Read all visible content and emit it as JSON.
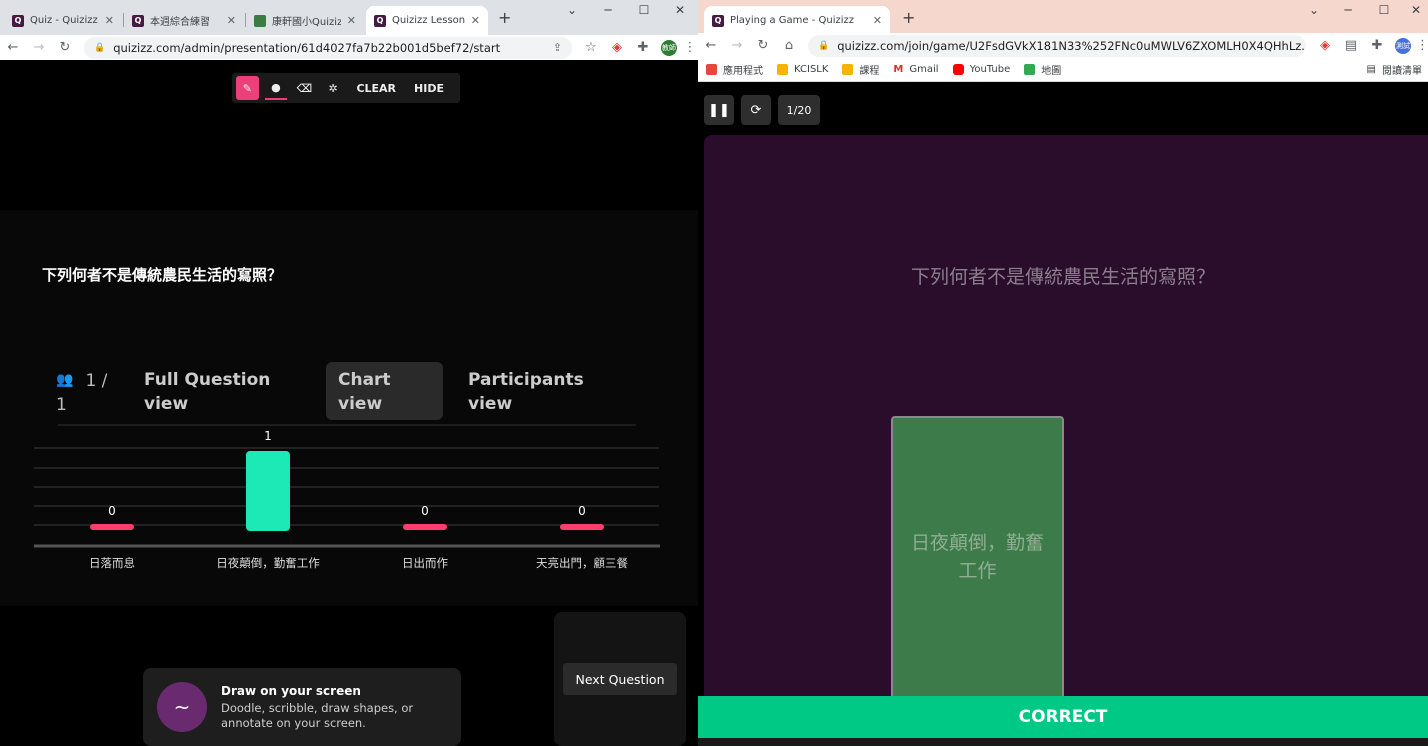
{
  "left_browser": {
    "tabs": [
      {
        "label": "Quiz - Quizizz",
        "active": false
      },
      {
        "label": "本週綜合練習",
        "active": false
      },
      {
        "label": "康軒國小Quizizz",
        "active": false
      },
      {
        "label": "Quizizz Lesson",
        "active": true
      }
    ],
    "url": "quizizz.com/admin/presentation/61d4027fa7b22b001d5bef72/start",
    "profile_label": "教師"
  },
  "draw_toolbar": {
    "clear_label": "CLEAR",
    "hide_label": "HIDE"
  },
  "presentation": {
    "question": "下列何者不是傳統農民生活的寫照？",
    "respondents_line1": "1 /",
    "respondents_line2": "1",
    "views": [
      {
        "line1": "Full Question",
        "line2": "view",
        "active": false
      },
      {
        "line1": "Chart",
        "line2": "view",
        "active": true
      },
      {
        "line1": "Participants",
        "line2": "view",
        "active": false
      }
    ]
  },
  "chart_data": {
    "type": "bar",
    "categories": [
      "日落而息",
      "日夜顛倒，勤奮工作",
      "日出而作",
      "天亮出門，顧三餐"
    ],
    "values": [
      0,
      1,
      0,
      0
    ],
    "ylim": [
      0,
      1
    ],
    "colors": {
      "bar": "#1de9b6",
      "zero": "#ff3d6e"
    },
    "grid": true
  },
  "draw_card": {
    "title": "Draw on your screen",
    "description_line1": "Doodle, scribble, draw shapes, or",
    "description_line2": "annotate on your screen."
  },
  "next_button_label": "Next Question",
  "right_browser": {
    "tab_label": "Playing a Game - Quizizz",
    "url": "quizizz.com/join/game/U2FsdGVkX181N33%252FNc0uMWLV6ZXOMLH0X4QHhLz...",
    "profile_label": "測試",
    "bookmarks": [
      "應用程式",
      "KCISLK",
      "課程",
      "Gmail",
      "YouTube",
      "地圖"
    ],
    "bookmarks_right": "閱讀清單"
  },
  "game": {
    "progress": "1/20",
    "question": "下列何者不是傳統農民生活的寫照？",
    "selected_answer_line1": "日夜顛倒，勤奮",
    "selected_answer_line2": "工作",
    "result": "CORRECT"
  }
}
